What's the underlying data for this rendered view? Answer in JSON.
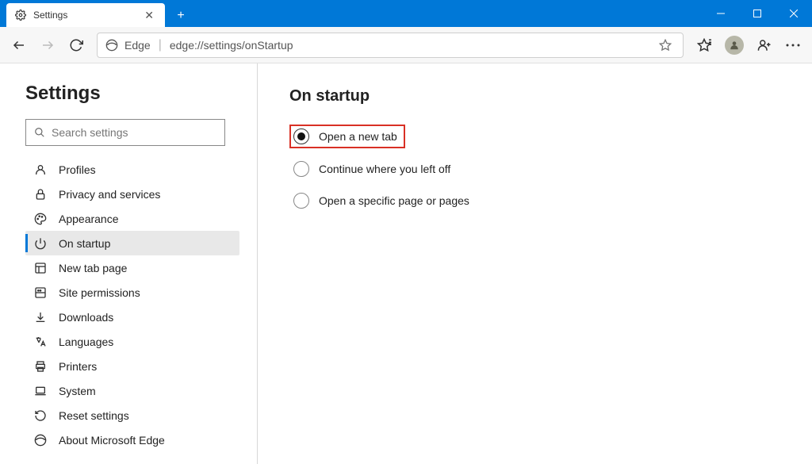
{
  "titlebar": {
    "tab": {
      "label": "Settings"
    }
  },
  "toolbar": {
    "edge_label": "Edge",
    "url": "edge://settings/onStartup"
  },
  "sidebar": {
    "title": "Settings",
    "search_placeholder": "Search settings",
    "items": [
      {
        "id": "profiles",
        "label": "Profiles",
        "icon": "person"
      },
      {
        "id": "privacy",
        "label": "Privacy and services",
        "icon": "lock"
      },
      {
        "id": "appearance",
        "label": "Appearance",
        "icon": "palette"
      },
      {
        "id": "onstartup",
        "label": "On startup",
        "icon": "power"
      },
      {
        "id": "newtab",
        "label": "New tab page",
        "icon": "grid"
      },
      {
        "id": "sitepermissions",
        "label": "Site permissions",
        "icon": "site"
      },
      {
        "id": "downloads",
        "label": "Downloads",
        "icon": "download"
      },
      {
        "id": "languages",
        "label": "Languages",
        "icon": "language"
      },
      {
        "id": "printers",
        "label": "Printers",
        "icon": "printer"
      },
      {
        "id": "system",
        "label": "System",
        "icon": "laptop"
      },
      {
        "id": "reset",
        "label": "Reset settings",
        "icon": "reset"
      },
      {
        "id": "about",
        "label": "About Microsoft Edge",
        "icon": "edge"
      }
    ],
    "active": "onstartup"
  },
  "main": {
    "title": "On startup",
    "options": [
      {
        "id": "newtab",
        "label": "Open a new tab",
        "selected": true,
        "highlighted": true
      },
      {
        "id": "continue",
        "label": "Continue where you left off",
        "selected": false
      },
      {
        "id": "specific",
        "label": "Open a specific page or pages",
        "selected": false
      }
    ]
  }
}
